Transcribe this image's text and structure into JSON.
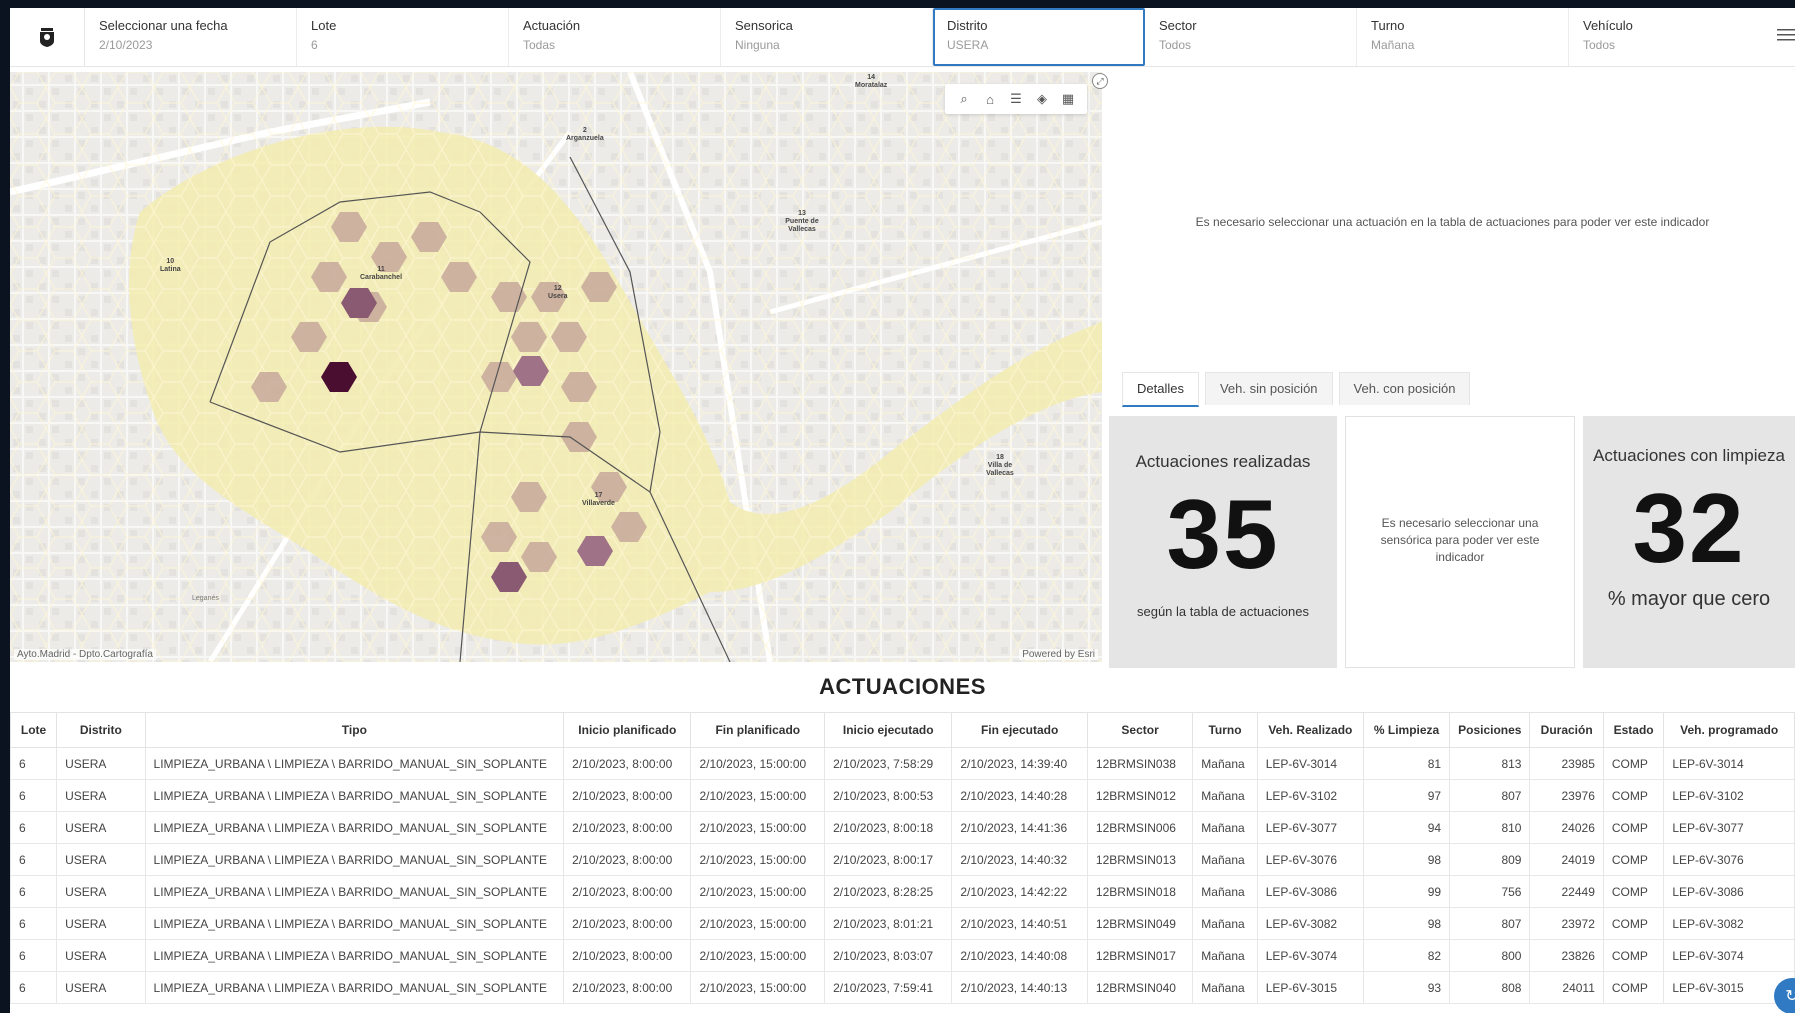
{
  "filters": [
    {
      "label": "Seleccionar una fecha",
      "value": "2/10/2023"
    },
    {
      "label": "Lote",
      "value": "6"
    },
    {
      "label": "Actuación",
      "value": "Todas"
    },
    {
      "label": "Sensorica",
      "value": "Ninguna"
    },
    {
      "label": "Distrito",
      "value": "USERA"
    },
    {
      "label": "Sector",
      "value": "Todos"
    },
    {
      "label": "Turno",
      "value": "Mañana"
    },
    {
      "label": "Vehículo",
      "value": "Todos"
    }
  ],
  "map": {
    "labels": [
      {
        "num": "14",
        "name": "Moratalaz"
      },
      {
        "num": "2",
        "name": "Arganzuela"
      },
      {
        "num": "13",
        "name": "Puente de Vallecas"
      },
      {
        "num": "10",
        "name": "Latina"
      },
      {
        "num": "11",
        "name": "Carabanchel"
      },
      {
        "num": "12",
        "name": "Usera"
      },
      {
        "num": "18",
        "name": "Villa de Vallecas"
      },
      {
        "num": "17",
        "name": "Villaverde"
      },
      {
        "num": "",
        "name": "Leganés"
      }
    ],
    "attribution_left": "Ayto.Madrid - Dpto.Cartografía",
    "attribution_right": "Powered by Esri",
    "tools": [
      "search-icon",
      "home-icon",
      "list-icon",
      "layers-icon",
      "grid-icon"
    ]
  },
  "indicator_message": "Es necesario seleccionar una actuación en la tabla de actuaciones para poder ver este indicador",
  "tabs": [
    "Detalles",
    "Veh. sin posición",
    "Veh. con posición"
  ],
  "cards": {
    "realizadas": {
      "title": "Actuaciones realizadas",
      "value": "35",
      "sub": "según la tabla de actuaciones"
    },
    "sensorica": {
      "message": "Es necesario seleccionar una sensórica para poder ver este indicador"
    },
    "limpieza": {
      "title": "Actuaciones con limpieza",
      "value": "32",
      "sub": "% mayor que cero"
    }
  },
  "table": {
    "title": "ACTUACIONES",
    "columns": [
      "Lote",
      "Distrito",
      "Tipo",
      "Inicio planificado",
      "Fin planificado",
      "Inicio ejecutado",
      "Fin ejecutado",
      "Sector",
      "Turno",
      "Veh. Realizado",
      "% Limpieza",
      "Posiciones",
      "Duración",
      "Estado",
      "Veh. programado"
    ],
    "rows": [
      [
        "6",
        "USERA",
        "LIMPIEZA_URBANA \\ LIMPIEZA \\ BARRIDO_MANUAL_SIN_SOPLANTE",
        "2/10/2023, 8:00:00",
        "2/10/2023, 15:00:00",
        "2/10/2023, 7:58:29",
        "2/10/2023, 14:39:40",
        "12BRMSIN038",
        "Mañana",
        "LEP-6V-3014",
        "81",
        "813",
        "23985",
        "COMP",
        "LEP-6V-3014"
      ],
      [
        "6",
        "USERA",
        "LIMPIEZA_URBANA \\ LIMPIEZA \\ BARRIDO_MANUAL_SIN_SOPLANTE",
        "2/10/2023, 8:00:00",
        "2/10/2023, 15:00:00",
        "2/10/2023, 8:00:53",
        "2/10/2023, 14:40:28",
        "12BRMSIN012",
        "Mañana",
        "LEP-6V-3102",
        "97",
        "807",
        "23976",
        "COMP",
        "LEP-6V-3102"
      ],
      [
        "6",
        "USERA",
        "LIMPIEZA_URBANA \\ LIMPIEZA \\ BARRIDO_MANUAL_SIN_SOPLANTE",
        "2/10/2023, 8:00:00",
        "2/10/2023, 15:00:00",
        "2/10/2023, 8:00:18",
        "2/10/2023, 14:41:36",
        "12BRMSIN006",
        "Mañana",
        "LEP-6V-3077",
        "94",
        "810",
        "24026",
        "COMP",
        "LEP-6V-3077"
      ],
      [
        "6",
        "USERA",
        "LIMPIEZA_URBANA \\ LIMPIEZA \\ BARRIDO_MANUAL_SIN_SOPLANTE",
        "2/10/2023, 8:00:00",
        "2/10/2023, 15:00:00",
        "2/10/2023, 8:00:17",
        "2/10/2023, 14:40:32",
        "12BRMSIN013",
        "Mañana",
        "LEP-6V-3076",
        "98",
        "809",
        "24019",
        "COMP",
        "LEP-6V-3076"
      ],
      [
        "6",
        "USERA",
        "LIMPIEZA_URBANA \\ LIMPIEZA \\ BARRIDO_MANUAL_SIN_SOPLANTE",
        "2/10/2023, 8:00:00",
        "2/10/2023, 15:00:00",
        "2/10/2023, 8:28:25",
        "2/10/2023, 14:42:22",
        "12BRMSIN018",
        "Mañana",
        "LEP-6V-3086",
        "99",
        "756",
        "22449",
        "COMP",
        "LEP-6V-3086"
      ],
      [
        "6",
        "USERA",
        "LIMPIEZA_URBANA \\ LIMPIEZA \\ BARRIDO_MANUAL_SIN_SOPLANTE",
        "2/10/2023, 8:00:00",
        "2/10/2023, 15:00:00",
        "2/10/2023, 8:01:21",
        "2/10/2023, 14:40:51",
        "12BRMSIN049",
        "Mañana",
        "LEP-6V-3082",
        "98",
        "807",
        "23972",
        "COMP",
        "LEP-6V-3082"
      ],
      [
        "6",
        "USERA",
        "LIMPIEZA_URBANA \\ LIMPIEZA \\ BARRIDO_MANUAL_SIN_SOPLANTE",
        "2/10/2023, 8:00:00",
        "2/10/2023, 15:00:00",
        "2/10/2023, 8:03:07",
        "2/10/2023, 14:40:08",
        "12BRMSIN017",
        "Mañana",
        "LEP-6V-3074",
        "82",
        "800",
        "23826",
        "COMP",
        "LEP-6V-3074"
      ],
      [
        "6",
        "USERA",
        "LIMPIEZA_URBANA \\ LIMPIEZA \\ BARRIDO_MANUAL_SIN_SOPLANTE",
        "2/10/2023, 8:00:00",
        "2/10/2023, 15:00:00",
        "2/10/2023, 7:59:41",
        "2/10/2023, 14:40:13",
        "12BRMSIN040",
        "Mañana",
        "LEP-6V-3015",
        "93",
        "808",
        "24011",
        "COMP",
        "LEP-6V-3015"
      ]
    ]
  }
}
